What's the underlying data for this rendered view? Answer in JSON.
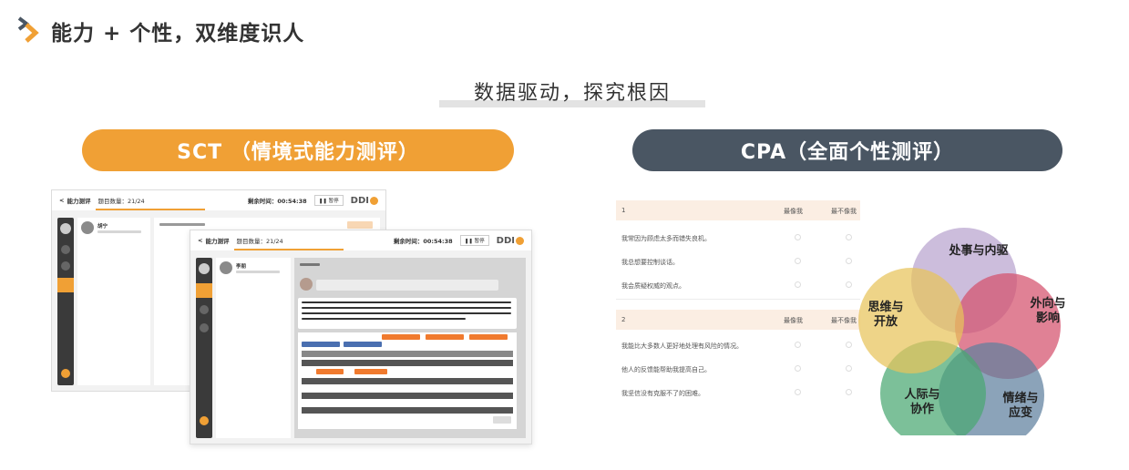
{
  "header": {
    "title": "能力 + 个性，双维度识人",
    "subtitle": "数据驱动，探究根因"
  },
  "sct": {
    "label": "SCT （情境式能力测评）",
    "app_title": "能力测评",
    "back_glyph": "<",
    "question_counter": "题目数量：21/24",
    "timer": "剩余时间：00:54:38",
    "pause_label": "暂停",
    "logo": "DDI",
    "contact_name": "李朋",
    "contact_name_back": "胡宁"
  },
  "cpa": {
    "label": "CPA（全面个性测评）",
    "groups": [
      {
        "number": "1",
        "col_a": "最像我",
        "col_b": "最不像我",
        "items": [
          "我常因为顾虑太多而错失良机。",
          "我总想要控制谈话。",
          "我会质疑权威的观点。"
        ]
      },
      {
        "number": "2",
        "col_a": "最像我",
        "col_b": "最不像我",
        "items": [
          "我能比大多数人更好地处理有风险的情况。",
          "他人的反馈能帮助我提高自己。",
          "我坚信没有克服不了的困难。"
        ]
      }
    ],
    "venn": {
      "circles": [
        {
          "label": "处事与内驱",
          "color": "#b9a3cf"
        },
        {
          "label": "外向与影响",
          "color": "#d4506c"
        },
        {
          "label": "情绪与应变",
          "color": "#5e7f9e"
        },
        {
          "label": "人际与协作",
          "color": "#4aa872"
        },
        {
          "label": "思维与开放",
          "color": "#e8c35a"
        }
      ]
    }
  },
  "colors": {
    "accent_orange": "#f0a035",
    "dark_slate": "#4a5663"
  }
}
